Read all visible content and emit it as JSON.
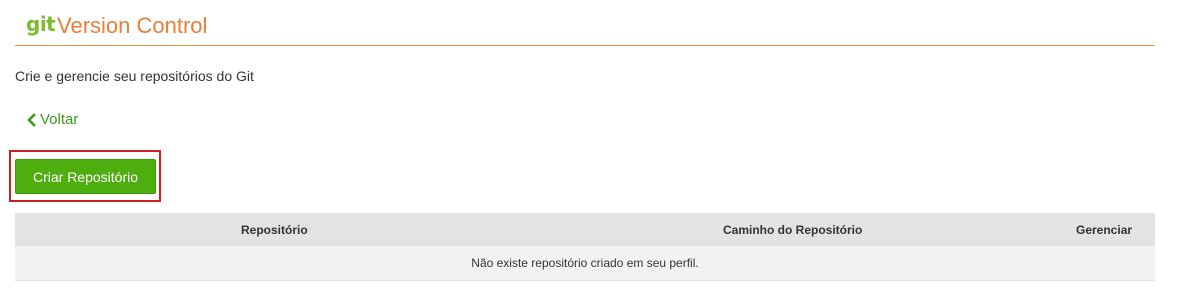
{
  "header": {
    "logo_text": "git",
    "title": "Version Control"
  },
  "subtitle": "Crie e gerencie seu repositórios do Git",
  "back_link": {
    "icon": "chevron-left-icon",
    "label": "Voltar"
  },
  "create_button": {
    "label": "Criar Repositório"
  },
  "table": {
    "columns": [
      "Repositório",
      "Caminho do Repositório",
      "Gerenciar"
    ],
    "empty_message": "Não existe repositório criado em seu perfil."
  },
  "colors": {
    "accent_orange": "#e57f3a",
    "logo_green": "#7cbb2a",
    "link_green": "#3e9a1f",
    "button_green": "#4fae0f",
    "highlight_red": "#cc1f1f"
  }
}
